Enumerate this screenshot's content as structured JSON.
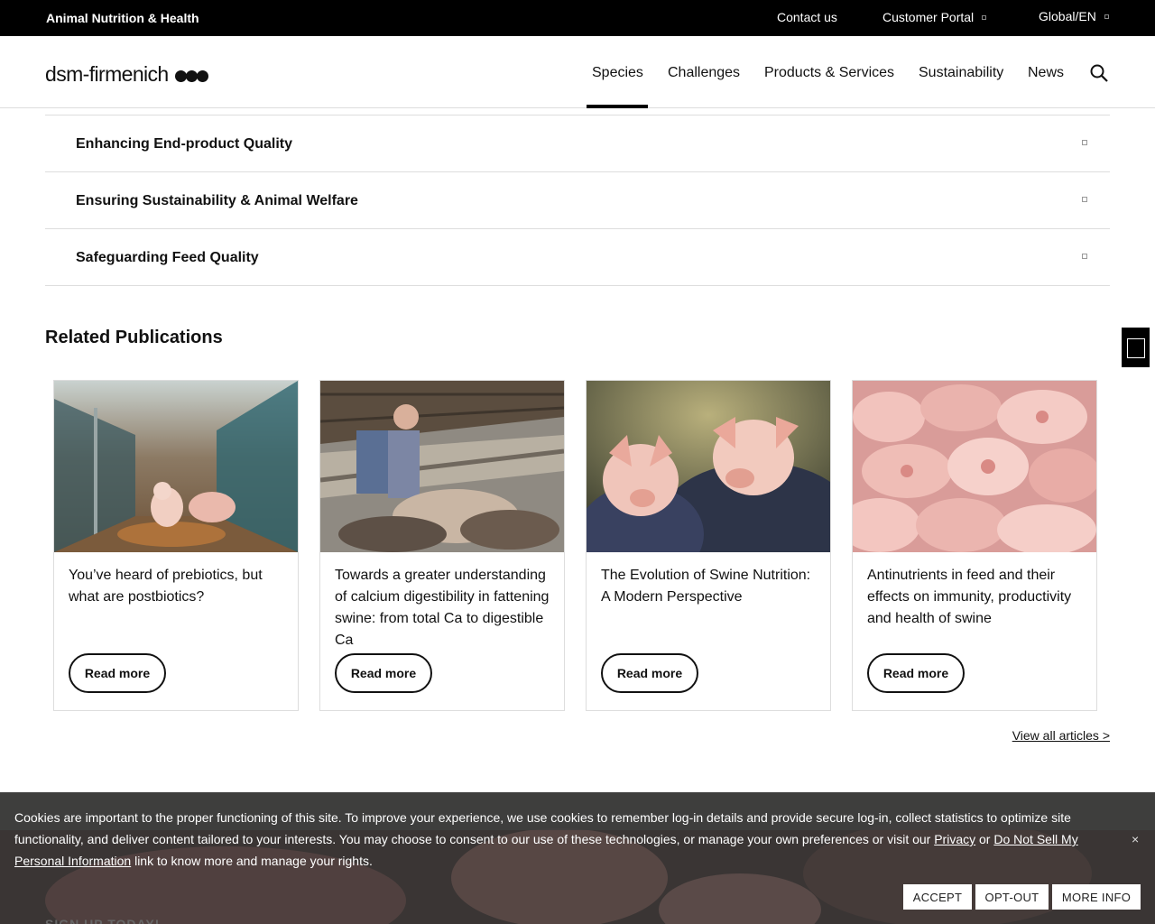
{
  "topbar": {
    "brand": "Animal Nutrition & Health",
    "links": [
      "Contact us",
      "Customer Portal",
      "Global/EN"
    ]
  },
  "header": {
    "logo_text": "dsm-firmenich",
    "nav": [
      "Species",
      "Challenges",
      "Products & Services",
      "Sustainability",
      "News"
    ],
    "active_nav": "Species"
  },
  "accordion": {
    "items": [
      "Enhancing End-product Quality",
      "Ensuring Sustainability & Animal Welfare",
      "Safeguarding Feed Quality"
    ]
  },
  "publications": {
    "title": "Related Publications",
    "cards": [
      {
        "title": "You’ve heard of prebiotics, but what are postbiotics?",
        "button": "Read more",
        "image": "two-piglets-in-barn-aisle"
      },
      {
        "title": "Towards a greater understanding of calcium digestibility in fattening swine: from total Ca to digestible Ca",
        "button": "Read more",
        "image": "farmer-inspecting-pigs-in-pen"
      },
      {
        "title": "The Evolution of Swine Nutrition: A Modern Perspective",
        "button": "Read more",
        "image": "farmer-holding-two-piglets"
      },
      {
        "title": "Antinutrients in feed and their effects on immunity, productivity and health of swine",
        "button": "Read more",
        "image": "crowd-of-pink-piglets"
      }
    ],
    "view_all": "View all articles >"
  },
  "cookie": {
    "text_before": "Cookies are important to the proper functioning of this site. To improve your experience, we use cookies to remember log-in details and provide secure log-in, collect statistics to optimize site functionality, and deliver content tailored to your interests. You may choose to consent to our use of these technologies, or manage your own preferences or visit our ",
    "privacy_link": "Privacy",
    "text_or": " or ",
    "dnsmpi_link": "Do Not Sell My Personal Information",
    "text_after": " link to know more and manage your rights.",
    "close": "×",
    "buttons": [
      "ACCEPT",
      "OPT-OUT",
      "MORE INFO"
    ],
    "background_heading": "SIGN UP TODAY!"
  }
}
